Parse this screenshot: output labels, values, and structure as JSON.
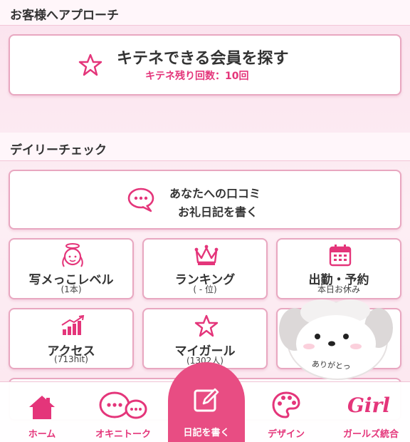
{
  "approach": {
    "heading": "お客様へアプローチ",
    "search_title": "キテネできる会員を探す",
    "remaining_label": "キテネ残り回数：10回"
  },
  "daily": {
    "heading": "デイリーチェック",
    "review_line1": "あなたへの口コミ",
    "review_line2": "お礼日記を書く",
    "tiles": [
      {
        "title": "写メっこレベル",
        "sub": "(1本)",
        "icon": "angel-icon"
      },
      {
        "title": "ランキング",
        "sub": "( - 位)",
        "icon": "crown-icon"
      },
      {
        "title": "出勤・予約",
        "sub": "本日お休み",
        "icon": "calendar-icon"
      },
      {
        "title": "アクセス",
        "sub": "(713hit)",
        "icon": "chart-up-icon"
      },
      {
        "title": "マイガール",
        "sub": "(1302人)",
        "icon": "star-icon"
      }
    ]
  },
  "mascot": {
    "caption": "ありがとっ"
  },
  "tabbar": {
    "home": "ホーム",
    "okini_talk": "オキニトーク",
    "write_diary": "日記を書く",
    "design": "デザイン",
    "girls": "ガールズ統合",
    "girls_logo": "Girl"
  },
  "colors": {
    "accent": "#e4357a",
    "border": "#e8a7c0"
  }
}
